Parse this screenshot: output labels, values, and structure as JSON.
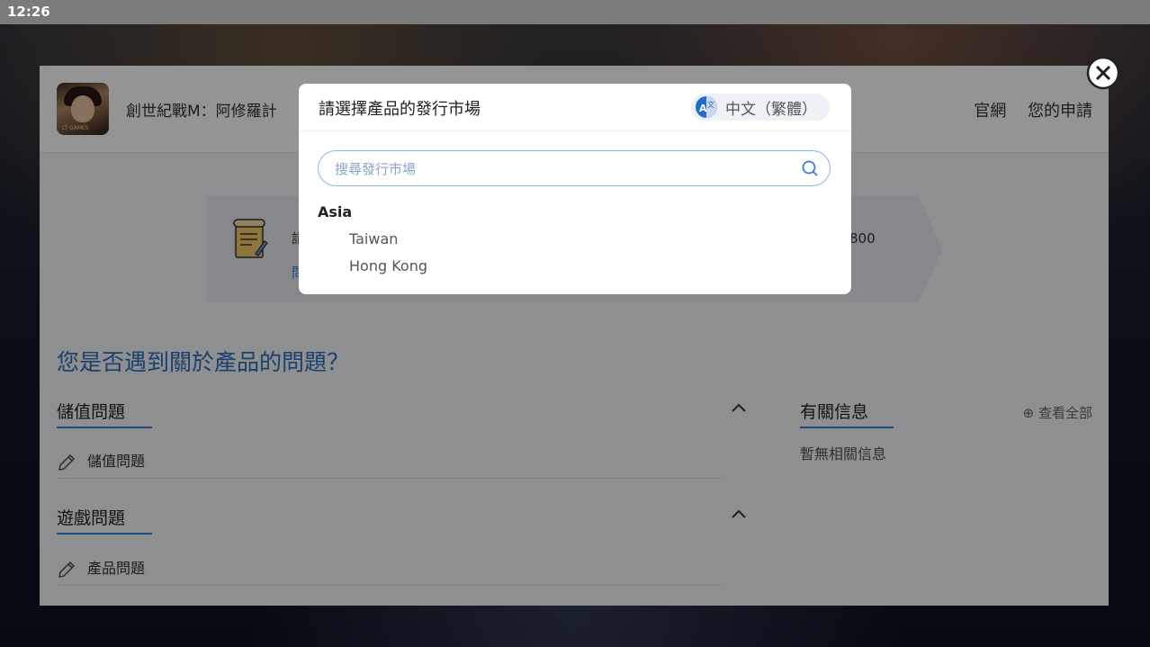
{
  "status_bar": {
    "time": "12:26"
  },
  "header": {
    "app_title": "創世紀戰M：阿修羅計",
    "links": [
      "官網",
      "您的申請"
    ],
    "app_icon_brand": "LT GAMES"
  },
  "card": {
    "text_partial": "請",
    "sub_partial": "問",
    "number_partial": "800"
  },
  "faq": {
    "question": "您是否遇到關於產品的問題？",
    "sections": [
      {
        "title": "儲值問題",
        "item": "儲值問題"
      },
      {
        "title": "遊戲問題",
        "item": "產品問題"
      }
    ]
  },
  "info": {
    "title": "有關信息",
    "view_all": "⊕ 查看全部",
    "empty": "暫無相關信息"
  },
  "modal": {
    "title": "請選擇產品的發行市場",
    "language": "中文（繁體）",
    "search_placeholder": "搜尋發行市場",
    "regions": [
      {
        "name": "Asia",
        "markets": [
          "Taiwan",
          "Hong Kong"
        ]
      }
    ]
  },
  "colors": {
    "accent": "#3a7bd5",
    "question_text": "#2f6fb8"
  }
}
